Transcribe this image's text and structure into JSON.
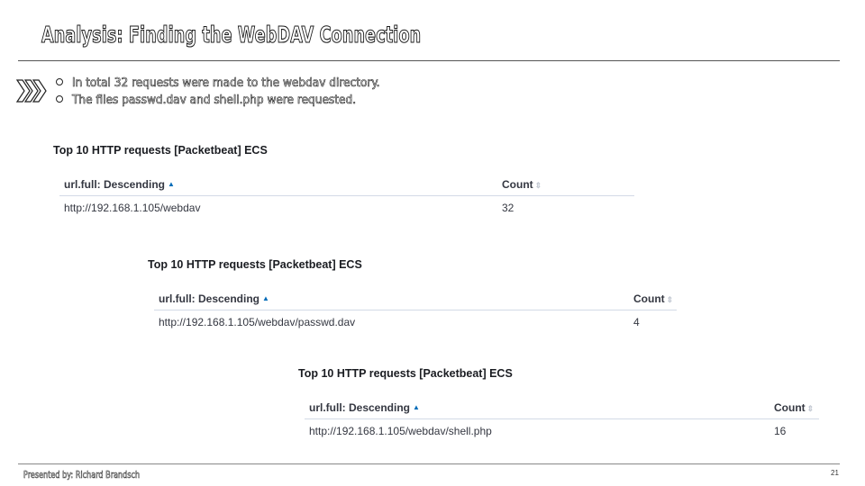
{
  "slide": {
    "title": "Analysis: Finding the WebDAV Connection",
    "bullets": [
      "In total 32 requests were made to the webdav directory.",
      "The files passwd.dav and shell.php were requested."
    ],
    "presenter": "Presented by: Richard Brandsch",
    "page_number": "21"
  },
  "panels": [
    {
      "title": "Top 10 HTTP requests [Packetbeat] ECS",
      "columns": [
        "url.full: Descending",
        "Count"
      ],
      "row": {
        "url": "http://192.168.1.105/webdav",
        "count": "32"
      }
    },
    {
      "title": "Top 10 HTTP requests [Packetbeat] ECS",
      "columns": [
        "url.full: Descending",
        "Count"
      ],
      "row": {
        "url": "http://192.168.1.105/webdav/passwd.dav",
        "count": "4"
      }
    },
    {
      "title": "Top 10 HTTP requests [Packetbeat] ECS",
      "columns": [
        "url.full: Descending",
        "Count"
      ],
      "row": {
        "url": "http://192.168.1.105/webdav/shell.php",
        "count": "16"
      }
    }
  ],
  "icons": {
    "bullet_marker": "chevrons-right-icon",
    "sort_ascending": "sort-ascending-icon",
    "sort_neutral": "sort-icon"
  },
  "colors": {
    "sort_active": "#006bb8",
    "sort_inactive": "#c2c8d2",
    "table_border": "#d3dae6"
  }
}
